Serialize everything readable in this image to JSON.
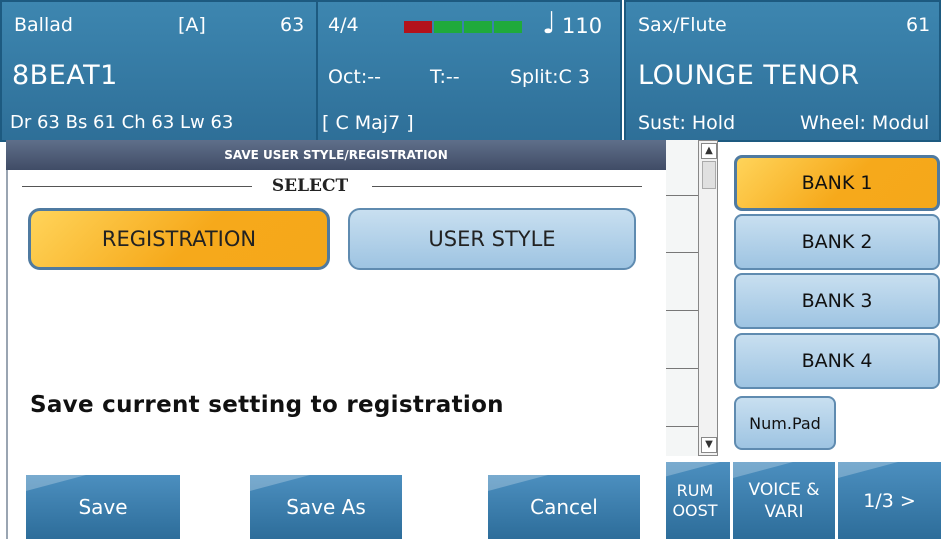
{
  "header": {
    "style_panel": {
      "style_name": "Ballad",
      "variation": "[A]",
      "style_number": "63",
      "style_title": "8BEAT1",
      "mix": "Dr 63   Bs 61  Ch 63  Lw 63"
    },
    "tempo_panel": {
      "time_signature": "4/4",
      "tempo_glyph": "♩",
      "tempo": "110",
      "octave": "Oct:--",
      "transpose": "T:--",
      "split": "Split:C 3",
      "chord": "[ C Maj7 ]",
      "meter_colors": [
        "#b3121c",
        "#1faa3c",
        "#1faa3c",
        "#1faa3c"
      ]
    },
    "voice_panel": {
      "voice_category": "Sax/Flute",
      "voice_number": "61",
      "voice_name": "LOUNGE TENOR",
      "sustain": "Sust: Hold",
      "wheel": "Wheel: Modul"
    }
  },
  "dialog": {
    "title": "SAVE USER STYLE/REGISTRATION",
    "select_label": "SELECT",
    "registration_label": "REGISTRATION",
    "user_style_label": "USER STYLE",
    "message": "Save current setting to registration",
    "save_label": "Save",
    "save_as_label": "Save As",
    "cancel_label": "Cancel"
  },
  "side": {
    "scroll_up": "▲",
    "scroll_down": "▼",
    "banks": [
      "BANK 1",
      "BANK 2",
      "BANK 3",
      "BANK 4"
    ],
    "numpad_label": "Num.Pad",
    "drum_line1": "RUM",
    "drum_line2": "OOST",
    "voice_line1": "VOICE &",
    "voice_line2": "VARI",
    "page_label": "1/3 >"
  },
  "colors": {
    "panel_blue": "#3a80ab",
    "selected_orange": "#f6a91b",
    "button_light_blue": "#b4d3ea"
  }
}
